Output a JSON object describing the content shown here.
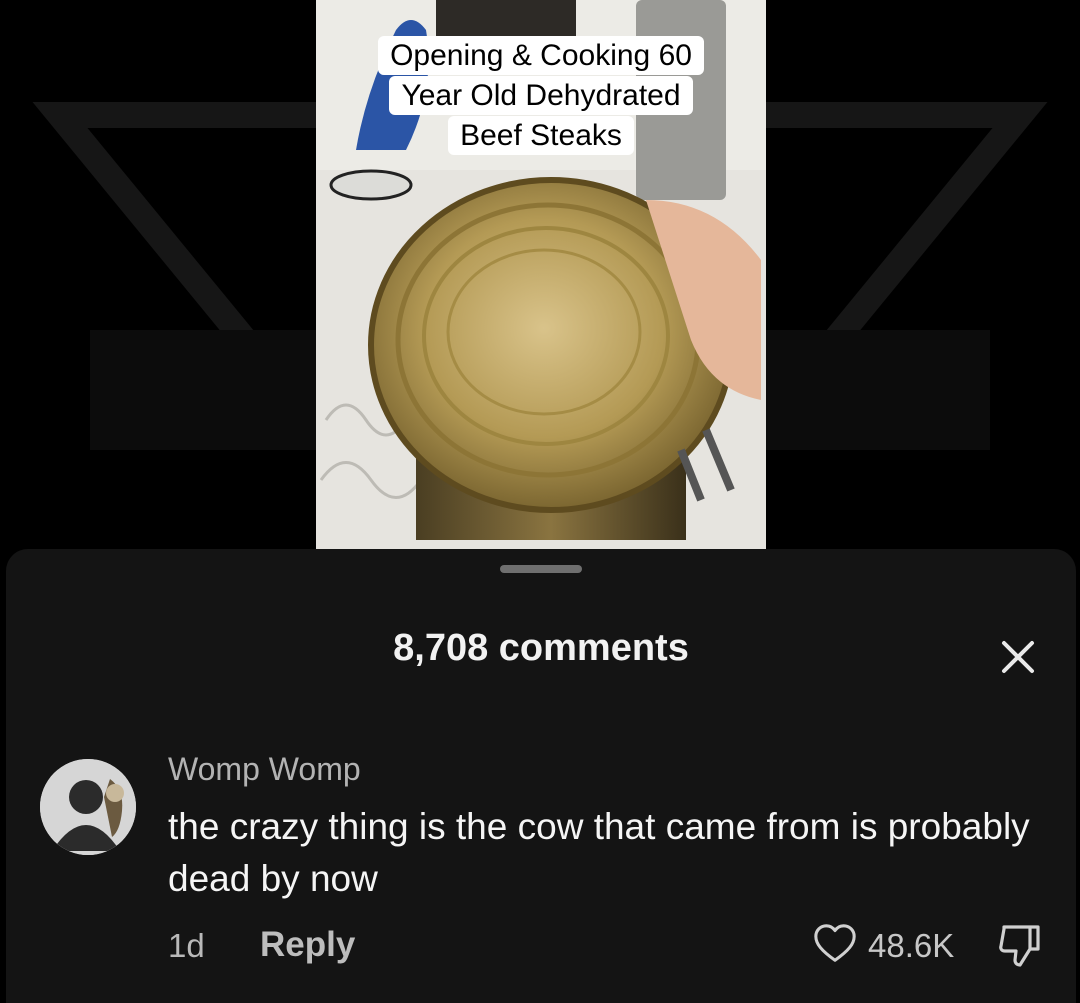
{
  "video": {
    "caption_lines": [
      "Opening & Cooking 60",
      "Year Old Dehydrated",
      "Beef Steaks"
    ]
  },
  "comments_panel": {
    "title": "8,708 comments",
    "close_icon": "close-icon"
  },
  "comment": {
    "author": "Womp Womp",
    "text": "the crazy thing is the cow that came from is probably dead by now",
    "age": "1d",
    "reply_label": "Reply",
    "like_count": "48.6K",
    "like_icon": "heart-outline-icon",
    "dislike_icon": "thumbs-down-icon",
    "avatar_icon": "default-avatar-icon"
  },
  "colors": {
    "background": "#000000",
    "sheet": "#141414",
    "secondary_text": "#b3b3b3"
  }
}
